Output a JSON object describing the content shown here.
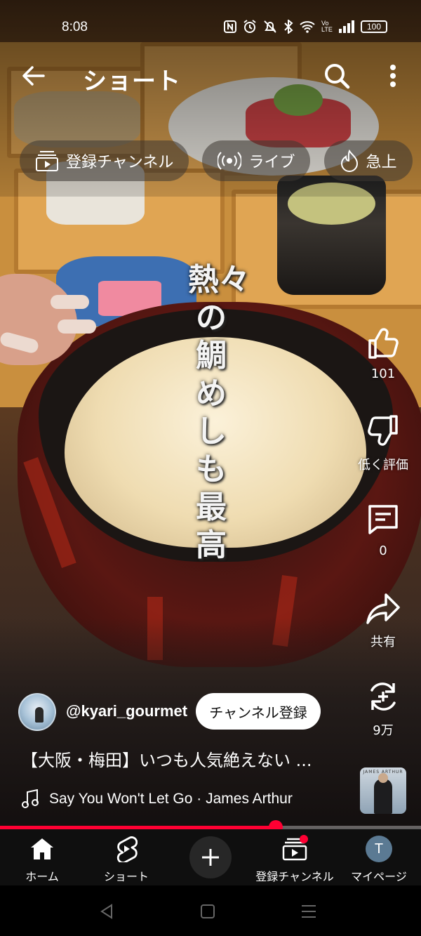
{
  "status_bar": {
    "time": "8:08",
    "network_label": "Vo LTE",
    "battery": "100",
    "icons": [
      "nfc-icon",
      "alarm-icon",
      "mute-icon",
      "bluetooth-icon",
      "wifi-icon",
      "volte-icon",
      "signal-icon",
      "battery-icon"
    ]
  },
  "header": {
    "title": "ショート",
    "back_icon": "arrow-left-icon",
    "search_icon": "search-icon",
    "more_icon": "more-vert-icon"
  },
  "chips": [
    {
      "label": "登録チャンネル",
      "icon": "subscriptions-icon"
    },
    {
      "label": "ライブ",
      "icon": "live-icon"
    },
    {
      "label": "急上",
      "icon": "trending-icon"
    }
  ],
  "overlay_caption": "熱々の鯛めしも最高",
  "actions": {
    "like": {
      "label": "101",
      "icon": "thumb-up-icon"
    },
    "dislike": {
      "label": "低く評価",
      "icon": "thumb-down-icon"
    },
    "comments": {
      "label": "0",
      "icon": "comment-icon"
    },
    "share": {
      "label": "共有",
      "icon": "share-icon"
    },
    "remix": {
      "label": "9万",
      "icon": "remix-icon"
    }
  },
  "channel": {
    "handle": "@kyari_gourmet",
    "subscribe_label": "チャンネル登録"
  },
  "video": {
    "title": "【大阪・梅田】いつも人気絶えない ...",
    "progress_percent": 65.5
  },
  "music": {
    "track": "Say You Won't Let Go · James Arthur",
    "thumb_text": "JAMES ARTHUR",
    "icon": "music-note-icon"
  },
  "bottom_nav": [
    {
      "label": "ホーム",
      "icon": "home-icon"
    },
    {
      "label": "ショート",
      "icon": "shorts-icon"
    },
    {
      "label": "",
      "icon": "create-plus-icon"
    },
    {
      "label": "登録チャンネル",
      "icon": "subscriptions-icon"
    },
    {
      "label": "マイページ",
      "icon": "avatar-icon",
      "avatar_letter": "T"
    }
  ],
  "colors": {
    "accent": "#ff0033",
    "nav_bg": "#0f0f0f"
  }
}
